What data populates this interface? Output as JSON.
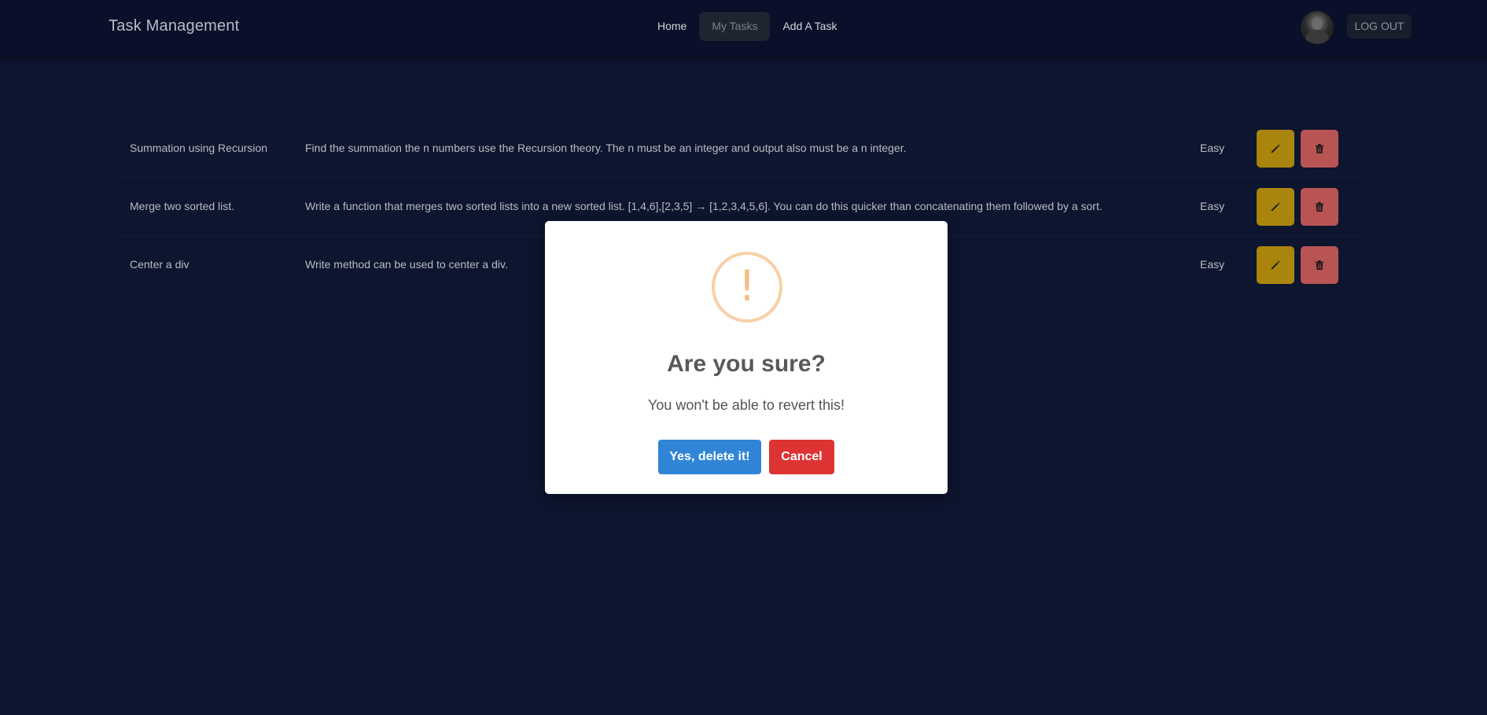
{
  "navbar": {
    "brand": "Task Management",
    "links": [
      {
        "label": "Home",
        "active": false
      },
      {
        "label": "My Tasks",
        "active": true
      },
      {
        "label": "Add A Task",
        "active": false
      }
    ],
    "logout_label": "LOG OUT"
  },
  "tasks": [
    {
      "title": "Summation using Recursion",
      "description": "Find the summation the n numbers use the Recursion theory. The n must be an integer and output also must be a n integer.",
      "level": "Easy"
    },
    {
      "title": "Merge two sorted list.",
      "description": "Write a function that merges two sorted lists into a new sorted list. [1,4,6],[2,3,5] → [1,2,3,4,5,6]. You can do this quicker than concatenating them followed by a sort.",
      "level": "Easy"
    },
    {
      "title": "Center a div",
      "description": "Write method can be used to center a div.",
      "level": "Easy"
    }
  ],
  "modal": {
    "icon_glyph": "!",
    "title": "Are you sure?",
    "text": "You won't be able to revert this!",
    "confirm_label": "Yes, delete it!",
    "cancel_label": "Cancel"
  },
  "icons": {
    "edit": "pencil-icon",
    "delete": "trash-icon",
    "warning": "warning-icon"
  },
  "colors": {
    "background": "#0f1733",
    "navbar": "#0a1029",
    "edit_button": "#b8910f",
    "delete_button": "#c85c5c",
    "confirm": "#3085d6",
    "cancel": "#dd3333",
    "warning": "#f8bb86"
  }
}
